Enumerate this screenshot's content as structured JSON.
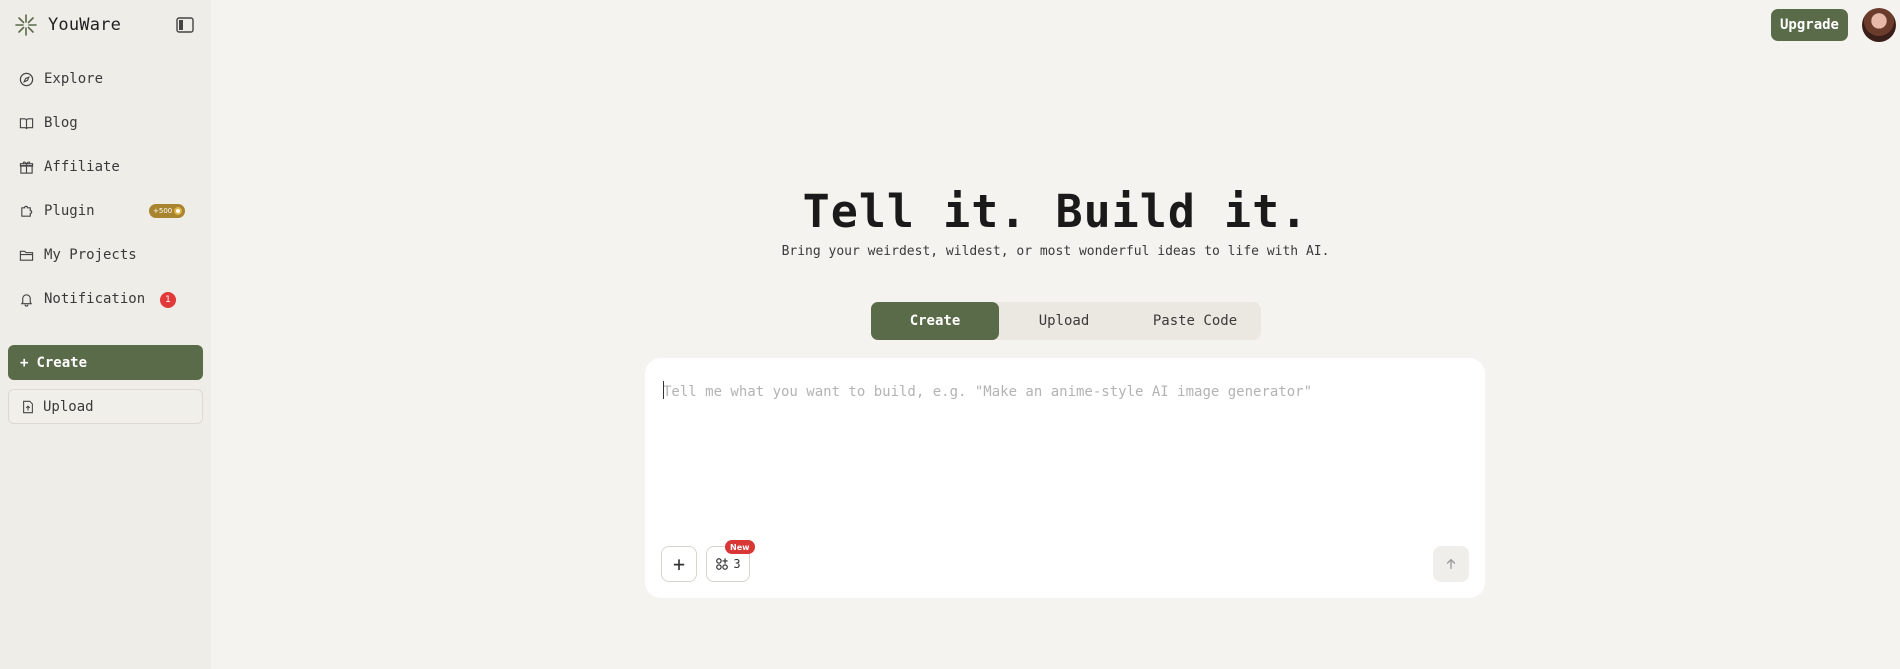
{
  "brand": {
    "name": "YouWare"
  },
  "sidebar": {
    "items": [
      {
        "label": "Explore",
        "icon": "compass-icon"
      },
      {
        "label": "Blog",
        "icon": "book-icon"
      },
      {
        "label": "Affiliate",
        "icon": "gift-icon"
      },
      {
        "label": "Plugin",
        "icon": "puzzle-icon",
        "badge": "+500"
      },
      {
        "label": "My Projects",
        "icon": "folder-icon"
      },
      {
        "label": "Notification",
        "icon": "bell-icon",
        "badge": "1"
      }
    ],
    "create_label": "Create",
    "upload_label": "Upload"
  },
  "header": {
    "upgrade_label": "Upgrade"
  },
  "hero": {
    "title": "Tell it. Build it.",
    "subtitle": "Bring your weirdest, wildest, or most wonderful ideas to life with AI."
  },
  "mode_tabs": [
    {
      "label": "Create",
      "active": true
    },
    {
      "label": "Upload",
      "active": false
    },
    {
      "label": "Paste Code",
      "active": false
    }
  ],
  "prompt": {
    "placeholder": "Tell me what you want to build, e.g. \"Make an anime-style AI image generator\"",
    "value": "",
    "tools_count": "3",
    "new_badge": "New"
  },
  "colors": {
    "accent": "#5a6b4a",
    "background": "#f5f3ef",
    "sidebar": "#efede8",
    "badge_red": "#e23a3a",
    "badge_gold": "#a8842e"
  }
}
